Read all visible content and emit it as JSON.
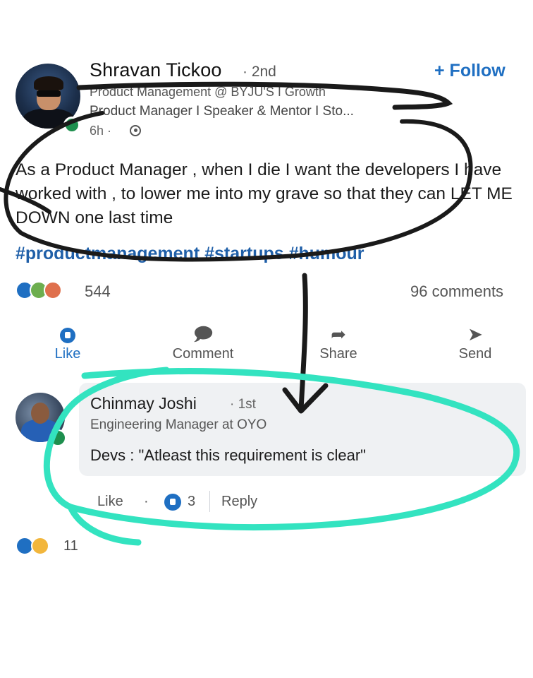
{
  "post": {
    "author_name": "Shravan Tickoo",
    "degree": "· 2nd",
    "follow_label": "+ Follow",
    "headline_line1": "Product Management @ BYJU'S I Growth",
    "headline_line2": "Product Manager I Speaker & Mentor I Sto...",
    "time": "6h ·",
    "text": "As a Product Manager , when I die I want the developers I have worked with , to lower me into my grave so that they can LET ME DOWN one last time",
    "hashtags": "#productmanagement #startups #humour",
    "reactions_count": "544",
    "comments_count": "96 comments"
  },
  "actions": {
    "like": "Like",
    "comment": "Comment",
    "share": "Share",
    "send": "Send"
  },
  "comment": {
    "author_name": "Chinmay Joshi",
    "degree": "· 1st",
    "headline": "Engineering Manager at OYO",
    "text": "Devs : \"Atleast this requirement is clear\"",
    "like_label": "Like",
    "separator": "·",
    "like_count": "3",
    "reply_label": "Reply"
  },
  "footer": {
    "reactions_count": "11"
  },
  "colors": {
    "accent_blue": "#1f6fc2",
    "online_green": "#1e8f4e",
    "annotation_black": "#1a1a1a",
    "annotation_teal": "#33e3c0"
  },
  "icons": {
    "globe": "globe-icon",
    "like": "thumbs-up-icon",
    "comment": "speech-bubble-icon",
    "share": "share-arrow-icon",
    "send": "paper-plane-icon"
  }
}
